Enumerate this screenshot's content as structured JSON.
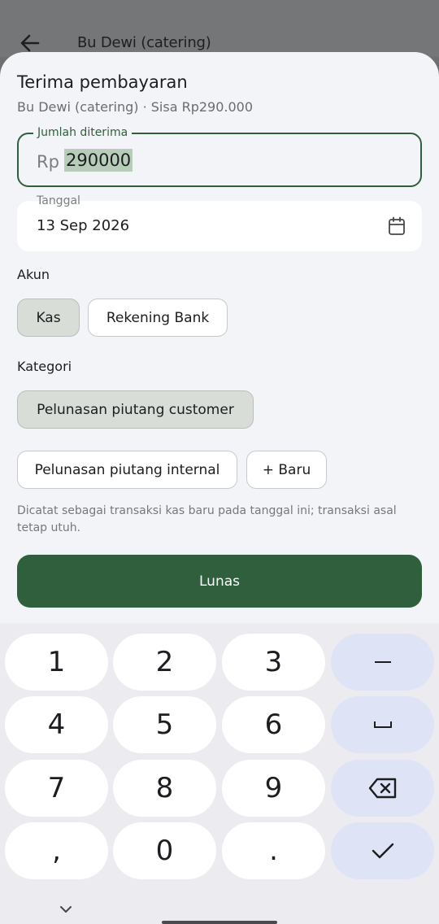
{
  "appbar": {
    "title": "Bu Dewi (catering)",
    "back_icon": "arrow-left-icon"
  },
  "sheet": {
    "title": "Terima pembayaran",
    "subtitle": "Bu Dewi (catering) · Sisa Rp290.000",
    "amount": {
      "label": "Jumlah diterima",
      "prefix": "Rp",
      "value": "290000"
    },
    "date": {
      "label": "Tanggal",
      "value": "13 Sep 2026",
      "icon": "calendar-icon"
    },
    "account": {
      "label": "Akun",
      "options": [
        "Kas",
        "Rekening Bank"
      ],
      "selected": "Kas"
    },
    "category": {
      "label": "Kategori",
      "options": [
        "Pelunasan piutang customer",
        "Pelunasan piutang internal"
      ],
      "selected": "Pelunasan piutang customer",
      "new_label": "+ Baru"
    },
    "note": "Dicatat sebagai transaksi kas baru pada tanggal ini; transaksi asal tetap utuh.",
    "submit_label": "Lunas"
  },
  "keyboard": {
    "keys": [
      "1",
      "2",
      "3",
      "4",
      "5",
      "6",
      "7",
      "8",
      "9",
      ",",
      "0",
      "."
    ],
    "function_keys": [
      "minus-icon",
      "space-icon",
      "backspace-icon",
      "checkmark-icon"
    ],
    "collapse_icon": "chevron-down-icon"
  },
  "colors": {
    "accent": "#2f5f3d",
    "selection": "#b7cdb9",
    "chip_selected": "#d8ddd8",
    "key_fn": "#dfe3f6"
  }
}
